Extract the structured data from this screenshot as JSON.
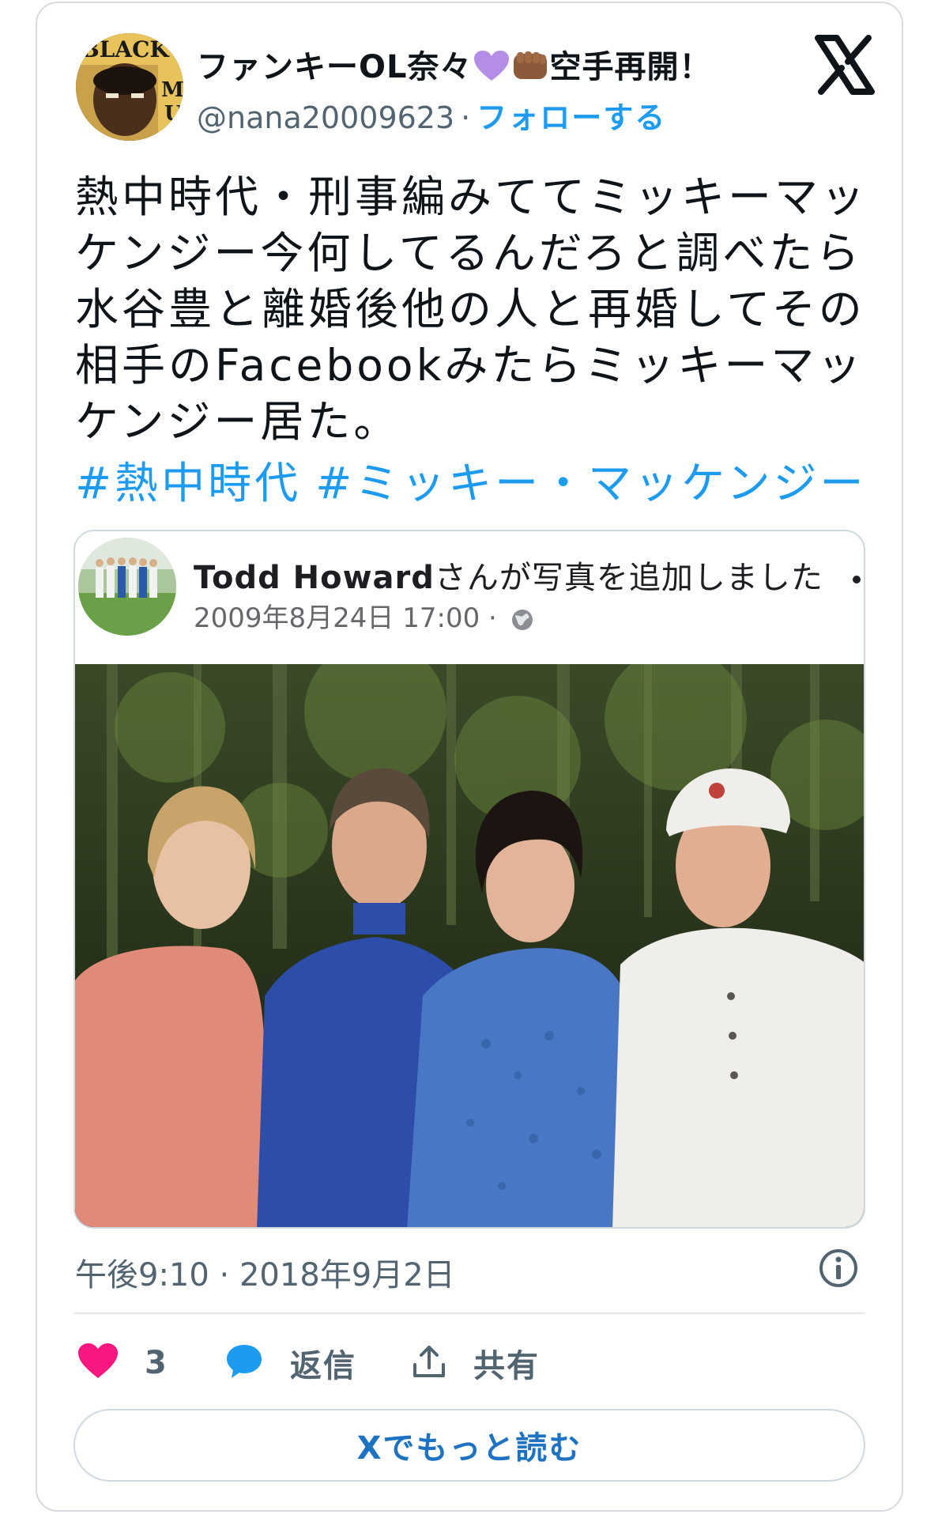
{
  "author": {
    "display_name_prefix": "ファンキーOL奈々",
    "display_name_suffix": "空手再開！",
    "emoji_1": "purple-heart",
    "emoji_2": "fist",
    "handle": "@nana20009623",
    "separator": "·",
    "follow_label": "フォローする"
  },
  "tweet": {
    "lines": [
      "熱中時代・刑事編みててミッキーマッ",
      "ケンジー今何してるんだろと調べたら",
      "水谷豊と離婚後他の人と再婚してその",
      "相手のFacebookみたらミッキーマッ",
      "ケンジー居た。"
    ],
    "hashtags": [
      "#熱中時代",
      "#ミッキー・マッケンジー"
    ]
  },
  "embed": {
    "poster_name": "Todd Howard",
    "action_text": "さんが写真を追加しました",
    "date": "2009年8月24日 17:00",
    "separator": "·",
    "privacy_icon": "globe-icon",
    "photo_description_icon": "group-photo"
  },
  "timestamp": "午後9:10 · 2018年9月2日",
  "actions": {
    "like_count": "3",
    "reply_label": "返信",
    "share_label": "共有"
  },
  "read_more_label": "Xでもっと読む",
  "colors": {
    "accent": "#1d9bf0",
    "like": "#f91880",
    "text": "#0f1419",
    "muted": "#536471"
  }
}
